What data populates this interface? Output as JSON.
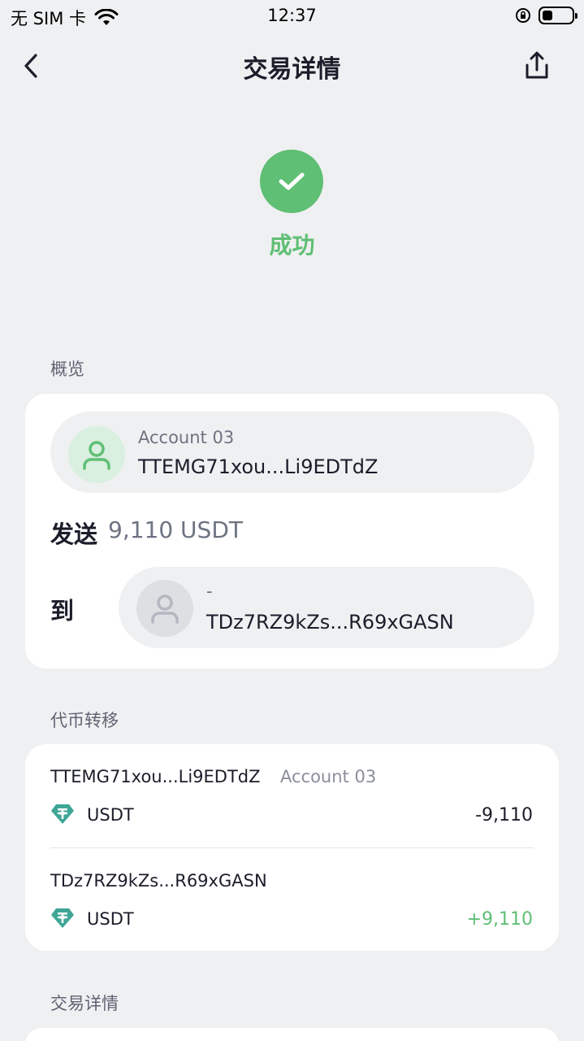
{
  "status_bar": {
    "carrier": "无 SIM 卡",
    "time": "12:37"
  },
  "nav": {
    "title": "交易详情"
  },
  "status": {
    "label": "成功",
    "color": "#5fbf74"
  },
  "overview": {
    "section_title": "概览",
    "from": {
      "name": "Account 03",
      "address": "TTEMG71xou...Li9EDTdZ"
    },
    "send_label": "发送",
    "send_amount": "9,110 USDT",
    "to_label": "到",
    "to": {
      "name": "-",
      "address": "TDz7RZ9kZs...R69xGASN"
    }
  },
  "token_transfers": {
    "section_title": "代币转移",
    "items": [
      {
        "address": "TTEMG71xou...Li9EDTdZ",
        "account": "Account 03",
        "token": "USDT",
        "icon": "tether-icon",
        "amount": "-9,110"
      },
      {
        "address": "TDz7RZ9kZs...R69xGASN",
        "account": "",
        "token": "USDT",
        "icon": "tether-icon",
        "amount": "+9,110"
      }
    ]
  },
  "details": {
    "section_title": "交易详情"
  }
}
